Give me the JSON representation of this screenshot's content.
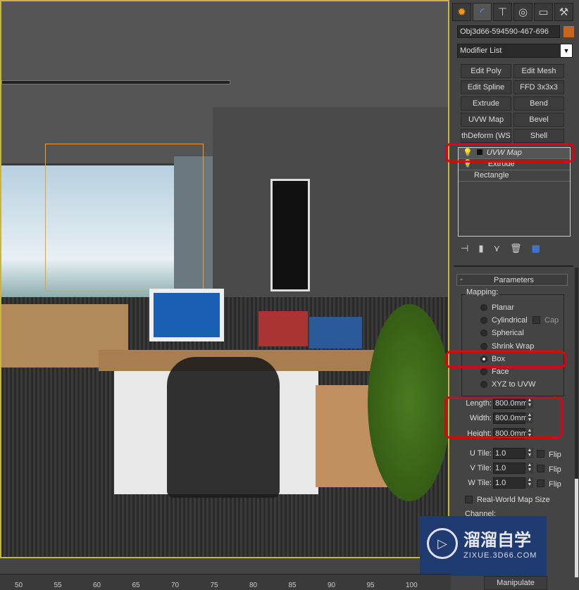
{
  "command_panel": {
    "tabs": [
      {
        "icon": "create-icon"
      },
      {
        "icon": "modify-icon",
        "active": true
      },
      {
        "icon": "hierarchy-icon"
      },
      {
        "icon": "motion-icon"
      },
      {
        "icon": "display-icon"
      },
      {
        "icon": "utilities-icon"
      }
    ],
    "object_name": "Obj3d66-594590-467-696",
    "object_color": "#c8641e",
    "modifier_list": "Modifier List",
    "modifier_buttons": [
      "Edit Poly",
      "Edit Mesh",
      "Edit Spline",
      "FFD 3x3x3",
      "Extrude",
      "Bend",
      "UVW Map",
      "Bevel",
      "thDeform (WSI",
      "Shell"
    ],
    "stack": [
      {
        "label": "UVW Map",
        "selected": true
      },
      {
        "label": "Extrude"
      },
      {
        "label": "Rectangle"
      }
    ],
    "parameters": {
      "title": "Parameters",
      "collapse": "-",
      "mapping_label": "Mapping:",
      "mapping_options": [
        "Planar",
        "Cylindrical",
        "Spherical",
        "Shrink Wrap",
        "Box",
        "Face",
        "XYZ to UVW"
      ],
      "selected_mapping": "Box",
      "cap_label": "Cap",
      "length_label": "Length:",
      "length": "800.0mm",
      "width_label": "Width:",
      "width": "800.0mm",
      "height_label": "Height:",
      "height": "800.0mm",
      "u_tile_label": "U Tile:",
      "u_tile": "1.0",
      "v_tile_label": "V Tile:",
      "v_tile": "1.0",
      "w_tile_label": "W Tile:",
      "w_tile": "1.0",
      "flip_label": "Flip",
      "real_world_label": "Real-World Map Size",
      "channel_label": "Channel:",
      "manipulate_label": "Manipulate"
    }
  },
  "watermark": {
    "title": "溜溜自学",
    "url": "ZIXUE.3D66.COM"
  },
  "ruler": {
    "ticks": [
      "50",
      "55",
      "60",
      "65",
      "70",
      "75",
      "80",
      "85",
      "90",
      "95",
      "100"
    ]
  },
  "colors": {
    "highlight": "#e00010",
    "selection": "#c8b440"
  }
}
